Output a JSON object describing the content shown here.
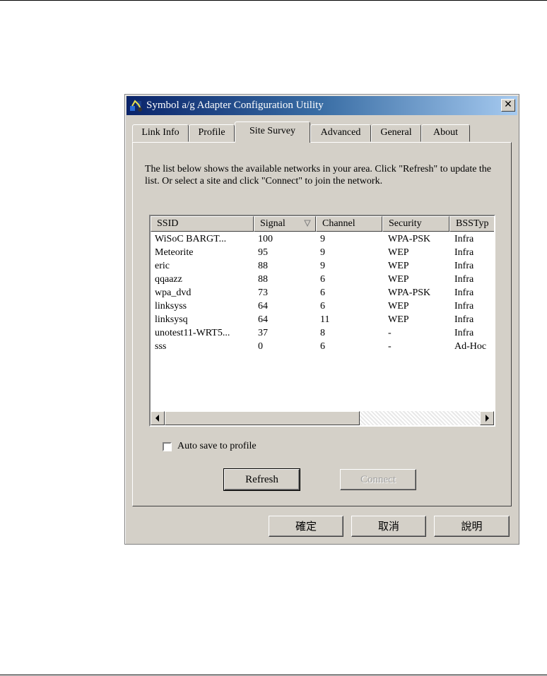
{
  "window": {
    "title": "Symbol a/g Adapter Configuration Utility",
    "close_glyph": "✕"
  },
  "tabs": [
    {
      "label": "Link Info"
    },
    {
      "label": "Profile"
    },
    {
      "label": "Site Survey",
      "active": true
    },
    {
      "label": "Advanced"
    },
    {
      "label": "General"
    },
    {
      "label": "About"
    }
  ],
  "site_survey": {
    "description": "The list below shows the available networks in your area. Click \"Refresh\" to update the list. Or select a site and click \"Connect\" to join the network.",
    "columns": [
      "SSID",
      "Signal",
      "Channel",
      "Security",
      "BSSTyp"
    ],
    "sort_icon": "sort-descending-icon",
    "rows": [
      [
        "WiSoC BARGT...",
        "100",
        "9",
        "WPA-PSK",
        "Infra"
      ],
      [
        "Meteorite",
        "95",
        "9",
        "WEP",
        "Infra"
      ],
      [
        "eric",
        "88",
        "9",
        "WEP",
        "Infra"
      ],
      [
        "qqaazz",
        "88",
        "6",
        "WEP",
        "Infra"
      ],
      [
        "wpa_dvd",
        "73",
        "6",
        "WPA-PSK",
        "Infra"
      ],
      [
        "linksyss",
        "64",
        "6",
        "WEP",
        "Infra"
      ],
      [
        "linksysq",
        "64",
        "11",
        "WEP",
        "Infra"
      ],
      [
        "unotest11-WRT5...",
        "37",
        "8",
        "-",
        "Infra"
      ],
      [
        "sss",
        "0",
        "6",
        "-",
        "Ad-Hoc"
      ]
    ],
    "auto_save_label": "Auto save to profile",
    "auto_save_checked": false,
    "refresh_label": "Refresh",
    "connect_label": "Connect"
  },
  "footer": {
    "ok_label": "確定",
    "cancel_label": "取消",
    "help_label": "說明"
  }
}
